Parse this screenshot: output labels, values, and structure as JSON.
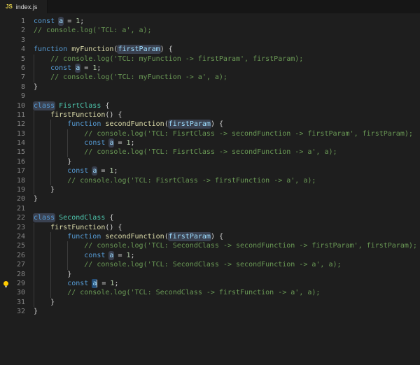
{
  "tab": {
    "icon_label": "JS",
    "title": "index.js"
  },
  "colors": {
    "editor_bg": "#1e1e1e",
    "tabbar_bg": "#161616",
    "tab_active_bg": "#1e1e1e",
    "keyword": "#569cd6",
    "function": "#dcdcaa",
    "class": "#4ec9b0",
    "variable": "#9cdcfe",
    "number": "#b5cea8",
    "comment": "#6a9955",
    "plain": "#d4d4d4",
    "line_number": "#858585",
    "word_highlight": "#3a4150",
    "selection": "#264f78",
    "indent_guide": "#3b3b3b",
    "lightbulb": "#ffcc00",
    "js_icon": "#e8d44d"
  },
  "editor": {
    "language": "javascript",
    "lightbulb_line": 29,
    "lines": [
      {
        "n": 1,
        "indent": 0,
        "tokens": [
          {
            "c": "kw",
            "t": "const"
          },
          {
            "c": "pl",
            "t": " "
          },
          {
            "c": "vr hl",
            "t": "a"
          },
          {
            "c": "pl",
            "t": " = "
          },
          {
            "c": "num",
            "t": "1"
          },
          {
            "c": "pl",
            "t": ";"
          }
        ]
      },
      {
        "n": 2,
        "indent": 0,
        "tokens": [
          {
            "c": "cm",
            "t": "// console.log('TCL: a', a);"
          }
        ]
      },
      {
        "n": 3,
        "indent": 0,
        "tokens": []
      },
      {
        "n": 4,
        "indent": 0,
        "tokens": [
          {
            "c": "kw",
            "t": "function"
          },
          {
            "c": "pl",
            "t": " "
          },
          {
            "c": "fn",
            "t": "myFunction"
          },
          {
            "c": "pl",
            "t": "("
          },
          {
            "c": "vr hl",
            "t": "firstParam"
          },
          {
            "c": "pl",
            "t": ") {"
          }
        ]
      },
      {
        "n": 5,
        "indent": 1,
        "tokens": [
          {
            "c": "cm",
            "t": "// console.log('TCL: myFunction -> firstParam', firstParam);"
          }
        ]
      },
      {
        "n": 6,
        "indent": 1,
        "tokens": [
          {
            "c": "kw",
            "t": "const"
          },
          {
            "c": "pl",
            "t": " "
          },
          {
            "c": "vr hl",
            "t": "a"
          },
          {
            "c": "pl",
            "t": " = "
          },
          {
            "c": "num",
            "t": "1"
          },
          {
            "c": "pl",
            "t": ";"
          }
        ]
      },
      {
        "n": 7,
        "indent": 1,
        "tokens": [
          {
            "c": "cm",
            "t": "// console.log('TCL: myFunction -> a', a);"
          }
        ]
      },
      {
        "n": 8,
        "indent": 0,
        "tokens": [
          {
            "c": "pl",
            "t": "}"
          }
        ]
      },
      {
        "n": 9,
        "indent": 0,
        "tokens": []
      },
      {
        "n": 10,
        "indent": 0,
        "tokens": [
          {
            "c": "kw hl",
            "t": "class"
          },
          {
            "c": "pl",
            "t": " "
          },
          {
            "c": "cl",
            "t": "FisrtClass"
          },
          {
            "c": "pl",
            "t": " {"
          }
        ]
      },
      {
        "n": 11,
        "indent": 1,
        "tokens": [
          {
            "c": "fn",
            "t": "firstFunction"
          },
          {
            "c": "pl",
            "t": "() {"
          }
        ]
      },
      {
        "n": 12,
        "indent": 2,
        "tokens": [
          {
            "c": "kw",
            "t": "function"
          },
          {
            "c": "pl",
            "t": " "
          },
          {
            "c": "fn",
            "t": "secondFunction"
          },
          {
            "c": "pl",
            "t": "("
          },
          {
            "c": "vr hl",
            "t": "firstParam"
          },
          {
            "c": "pl",
            "t": ") {"
          }
        ]
      },
      {
        "n": 13,
        "indent": 3,
        "tokens": [
          {
            "c": "cm",
            "t": "// console.log('TCL: FisrtClass -> secondFunction -> firstParam', firstParam);"
          }
        ]
      },
      {
        "n": 14,
        "indent": 3,
        "tokens": [
          {
            "c": "kw",
            "t": "const"
          },
          {
            "c": "pl",
            "t": " "
          },
          {
            "c": "vr hl",
            "t": "a"
          },
          {
            "c": "pl",
            "t": " = "
          },
          {
            "c": "num",
            "t": "1"
          },
          {
            "c": "pl",
            "t": ";"
          }
        ]
      },
      {
        "n": 15,
        "indent": 3,
        "tokens": [
          {
            "c": "cm",
            "t": "// console.log('TCL: FisrtClass -> secondFunction -> a', a);"
          }
        ]
      },
      {
        "n": 16,
        "indent": 2,
        "tokens": [
          {
            "c": "pl",
            "t": "}"
          }
        ]
      },
      {
        "n": 17,
        "indent": 2,
        "tokens": [
          {
            "c": "kw",
            "t": "const"
          },
          {
            "c": "pl",
            "t": " "
          },
          {
            "c": "vr hl",
            "t": "a"
          },
          {
            "c": "pl",
            "t": " = "
          },
          {
            "c": "num",
            "t": "1"
          },
          {
            "c": "pl",
            "t": ";"
          }
        ]
      },
      {
        "n": 18,
        "indent": 2,
        "tokens": [
          {
            "c": "cm",
            "t": "// console.log('TCL: FisrtClass -> firstFunction -> a', a);"
          }
        ]
      },
      {
        "n": 19,
        "indent": 1,
        "tokens": [
          {
            "c": "pl",
            "t": "}"
          }
        ]
      },
      {
        "n": 20,
        "indent": 0,
        "tokens": [
          {
            "c": "pl",
            "t": "}"
          }
        ]
      },
      {
        "n": 21,
        "indent": 0,
        "tokens": []
      },
      {
        "n": 22,
        "indent": 0,
        "tokens": [
          {
            "c": "kw hl",
            "t": "class"
          },
          {
            "c": "pl",
            "t": " "
          },
          {
            "c": "cl",
            "t": "SecondClass"
          },
          {
            "c": "pl",
            "t": " {"
          }
        ]
      },
      {
        "n": 23,
        "indent": 1,
        "tokens": [
          {
            "c": "fn",
            "t": "firstFunction"
          },
          {
            "c": "pl",
            "t": "() {"
          }
        ]
      },
      {
        "n": 24,
        "indent": 2,
        "tokens": [
          {
            "c": "kw",
            "t": "function"
          },
          {
            "c": "pl",
            "t": " "
          },
          {
            "c": "fn",
            "t": "secondFunction"
          },
          {
            "c": "pl",
            "t": "("
          },
          {
            "c": "vr hl",
            "t": "firstParam"
          },
          {
            "c": "pl",
            "t": ") {"
          }
        ]
      },
      {
        "n": 25,
        "indent": 3,
        "tokens": [
          {
            "c": "cm",
            "t": "// console.log('TCL: SecondClass -> secondFunction -> firstParam', firstParam);"
          }
        ]
      },
      {
        "n": 26,
        "indent": 3,
        "tokens": [
          {
            "c": "kw",
            "t": "const"
          },
          {
            "c": "pl",
            "t": " "
          },
          {
            "c": "vr hl",
            "t": "a"
          },
          {
            "c": "pl",
            "t": " = "
          },
          {
            "c": "num",
            "t": "1"
          },
          {
            "c": "pl",
            "t": ";"
          }
        ]
      },
      {
        "n": 27,
        "indent": 3,
        "tokens": [
          {
            "c": "cm",
            "t": "// console.log('TCL: SecondClass -> secondFunction -> a', a);"
          }
        ]
      },
      {
        "n": 28,
        "indent": 2,
        "tokens": [
          {
            "c": "pl",
            "t": "}"
          }
        ]
      },
      {
        "n": 29,
        "indent": 2,
        "tokens": [
          {
            "c": "kw",
            "t": "const"
          },
          {
            "c": "pl",
            "t": " "
          },
          {
            "c": "vr hl2",
            "t": "a"
          },
          {
            "c": "cur",
            "t": ""
          },
          {
            "c": "pl",
            "t": " = "
          },
          {
            "c": "num",
            "t": "1"
          },
          {
            "c": "pl",
            "t": ";"
          }
        ]
      },
      {
        "n": 30,
        "indent": 2,
        "tokens": [
          {
            "c": "cm",
            "t": "// console.log('TCL: SecondClass -> firstFunction -> a', a);"
          }
        ]
      },
      {
        "n": 31,
        "indent": 1,
        "tokens": [
          {
            "c": "pl",
            "t": "}"
          }
        ]
      },
      {
        "n": 32,
        "indent": 0,
        "tokens": [
          {
            "c": "pl",
            "t": "}"
          }
        ]
      }
    ]
  }
}
